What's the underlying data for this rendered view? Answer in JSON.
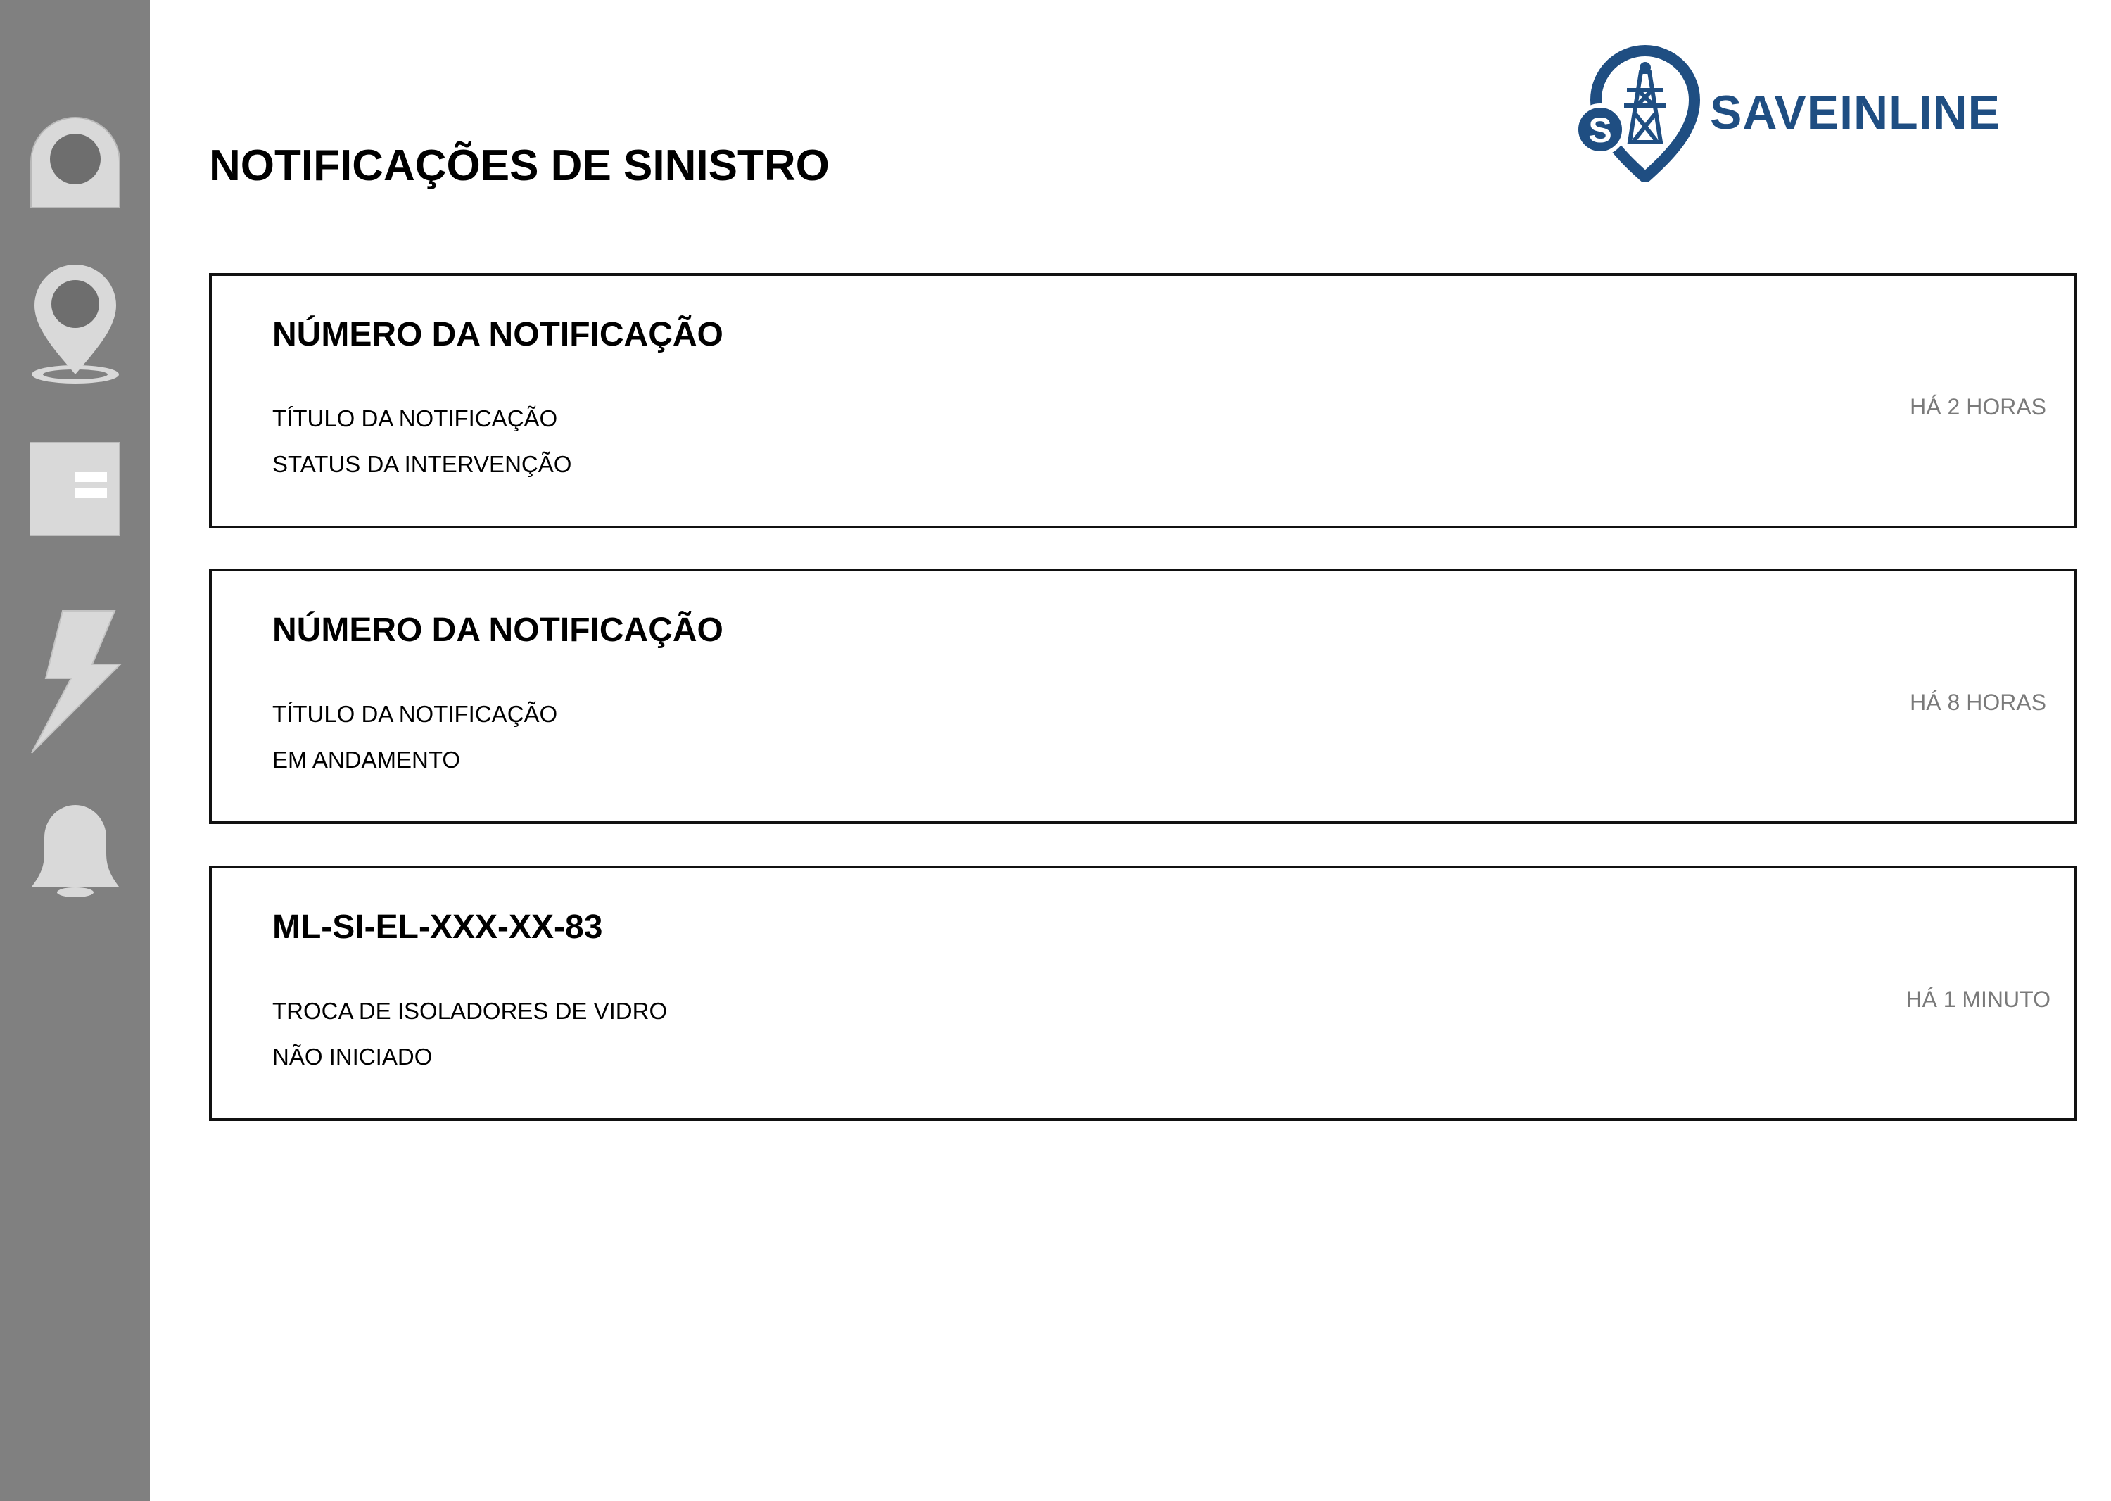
{
  "sidebar": {
    "items": [
      {
        "icon": "profile-icon"
      },
      {
        "icon": "location-pin-icon"
      },
      {
        "icon": "document-icon"
      },
      {
        "icon": "lightning-icon"
      },
      {
        "icon": "bell-icon"
      }
    ]
  },
  "header": {
    "title": "NOTIFICAÇÕES DE SINISTRO",
    "logo_text": "SAVEINLINE",
    "logo_letter": "S",
    "logo_icon": "transmission-tower-pin-icon"
  },
  "notifications": [
    {
      "number": "NÚMERO DA NOTIFICAÇÃO",
      "title": "TÍTULO DA NOTIFICAÇÃO",
      "status": "STATUS DA INTERVENÇÃO",
      "time": "HÁ 2 HORAS"
    },
    {
      "number": "NÚMERO DA NOTIFICAÇÃO",
      "title": "TÍTULO DA NOTIFICAÇÃO",
      "status": "EM ANDAMENTO",
      "time": "HÁ 8 HORAS"
    },
    {
      "number": "ML-SI-EL-XXX-XX-83",
      "title": "TROCA DE ISOLADORES DE VIDRO",
      "status": "NÃO INICIADO",
      "time": "HÁ 1 MINUTO"
    }
  ],
  "colors": {
    "sidebar_bg": "#808080",
    "icon_fill": "#d9d9d9",
    "brand": "#1f4e82",
    "time_text": "#7a7a7a"
  }
}
